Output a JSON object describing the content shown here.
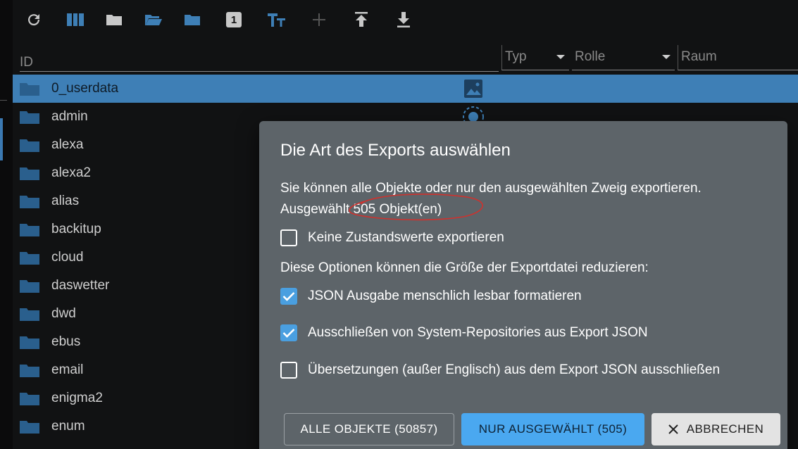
{
  "toolbar": {
    "icons": [
      "refresh-icon",
      "columns-icon",
      "folder-icon",
      "folder-open-icon",
      "folder-icon",
      "badge-1-icon",
      "text-size-icon",
      "add-icon",
      "upload-icon",
      "download-icon"
    ],
    "badge_text": "1"
  },
  "filters": {
    "id_placeholder": "ID",
    "typ_placeholder": "Typ",
    "rolle_placeholder": "Rolle",
    "raum_placeholder": "Raum"
  },
  "tree": {
    "items": [
      {
        "label": "0_userdata"
      },
      {
        "label": "admin"
      },
      {
        "label": "alexa"
      },
      {
        "label": "alexa2"
      },
      {
        "label": "alias"
      },
      {
        "label": "backitup"
      },
      {
        "label": "cloud"
      },
      {
        "label": "daswetter"
      },
      {
        "label": "dwd"
      },
      {
        "label": "ebus"
      },
      {
        "label": "email"
      },
      {
        "label": "enigma2"
      },
      {
        "label": "enum"
      }
    ]
  },
  "dialog": {
    "title": "Die Art des Exports auswählen",
    "description": "Sie können alle Objekte oder nur den ausgewählten Zweig exportieren.",
    "selected_text": "Ausgewählt 505 Objekt(en)",
    "option_no_states": "Keine Zustandswerte exportieren",
    "options_hint": "Diese Optionen können die Größe der Exportdatei reduzieren:",
    "option_pretty": "JSON Ausgabe menschlich lesbar formatieren",
    "option_exclude_repos": "Ausschließen von System-Repositories aus Export JSON",
    "option_exclude_translations": "Übersetzungen (außer Englisch) aus dem Export JSON ausschließen",
    "checks": {
      "no_states": false,
      "pretty": true,
      "exclude_repos": true,
      "exclude_translations": false
    },
    "btn_all": "ALLE OBJEKTE (50857)",
    "btn_selected": "NUR AUSGEWÄHLT (505)",
    "btn_cancel": "ABBRECHEN"
  },
  "colors": {
    "accent": "#3e7fb6",
    "primary_button": "#4aa8f0",
    "dialog_bg": "#5d6469",
    "annotation": "#d0312d"
  }
}
